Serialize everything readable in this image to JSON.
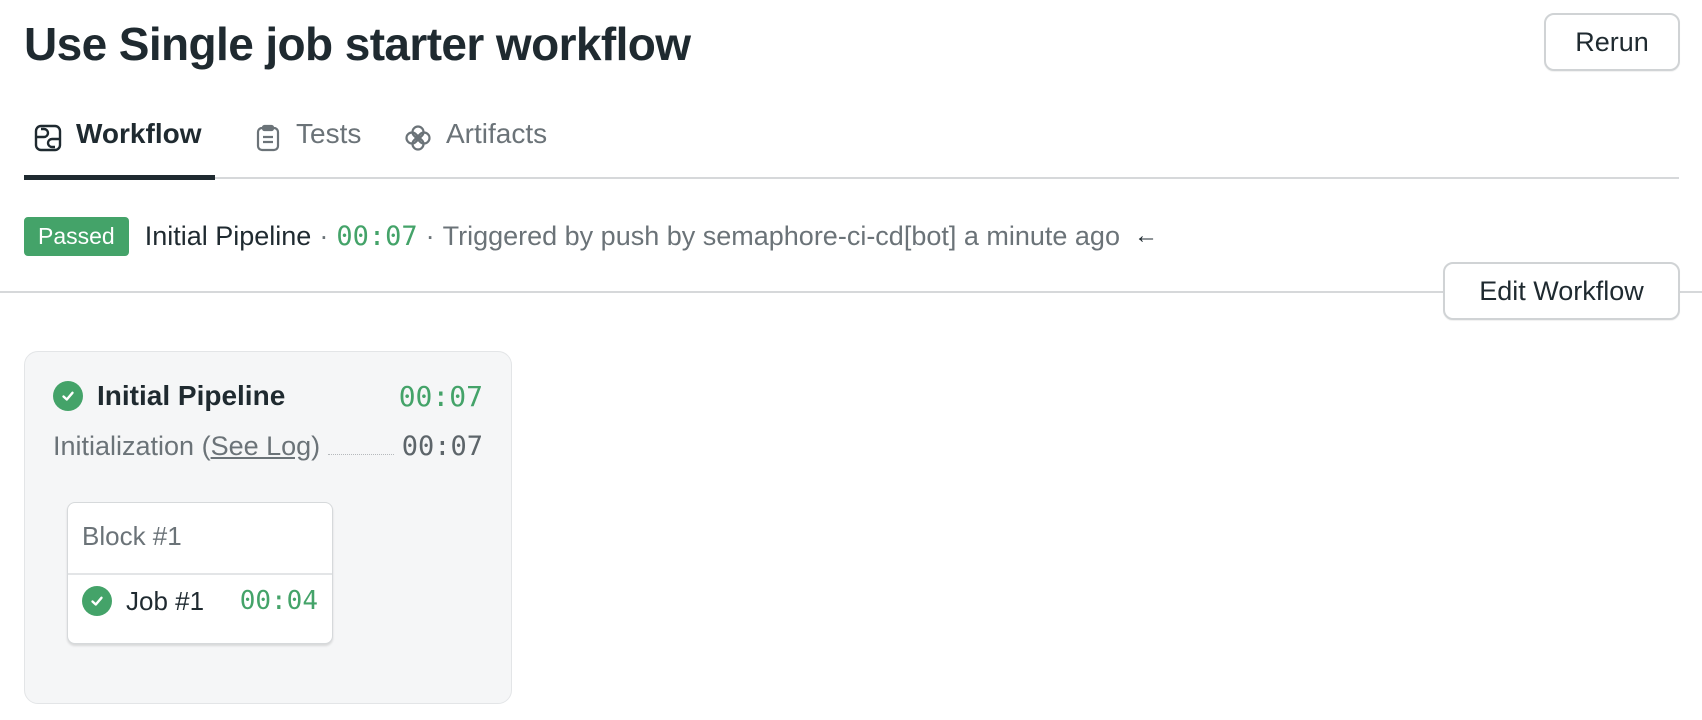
{
  "header": {
    "title": "Use Single job starter workflow",
    "rerun_label": "Rerun"
  },
  "tabs": [
    {
      "label": "Workflow",
      "icon": "workflow-icon",
      "active": true
    },
    {
      "label": "Tests",
      "icon": "clipboard-icon",
      "active": false
    },
    {
      "label": "Artifacts",
      "icon": "artifacts-icon",
      "active": false
    }
  ],
  "status": {
    "badge": "Passed",
    "pipeline_name": "Initial Pipeline",
    "separator": "·",
    "duration": "00:07",
    "trigger_text": "Triggered by push by semaphore-ci-cd[bot] a minute ago",
    "arrow": "←"
  },
  "edit_workflow_label": "Edit Workflow",
  "pipeline": {
    "title": "Initial Pipeline",
    "duration": "00:07",
    "status": "passed",
    "init_label": "Initialization (",
    "see_log": "See Log",
    "init_close": ")",
    "init_duration": "00:07",
    "blocks": [
      {
        "title": "Block #1",
        "jobs": [
          {
            "name": "Job #1",
            "duration": "00:04",
            "status": "passed"
          }
        ]
      }
    ]
  },
  "colors": {
    "success": "#44a369",
    "text": "#1f2a30",
    "muted": "#6b7378"
  }
}
